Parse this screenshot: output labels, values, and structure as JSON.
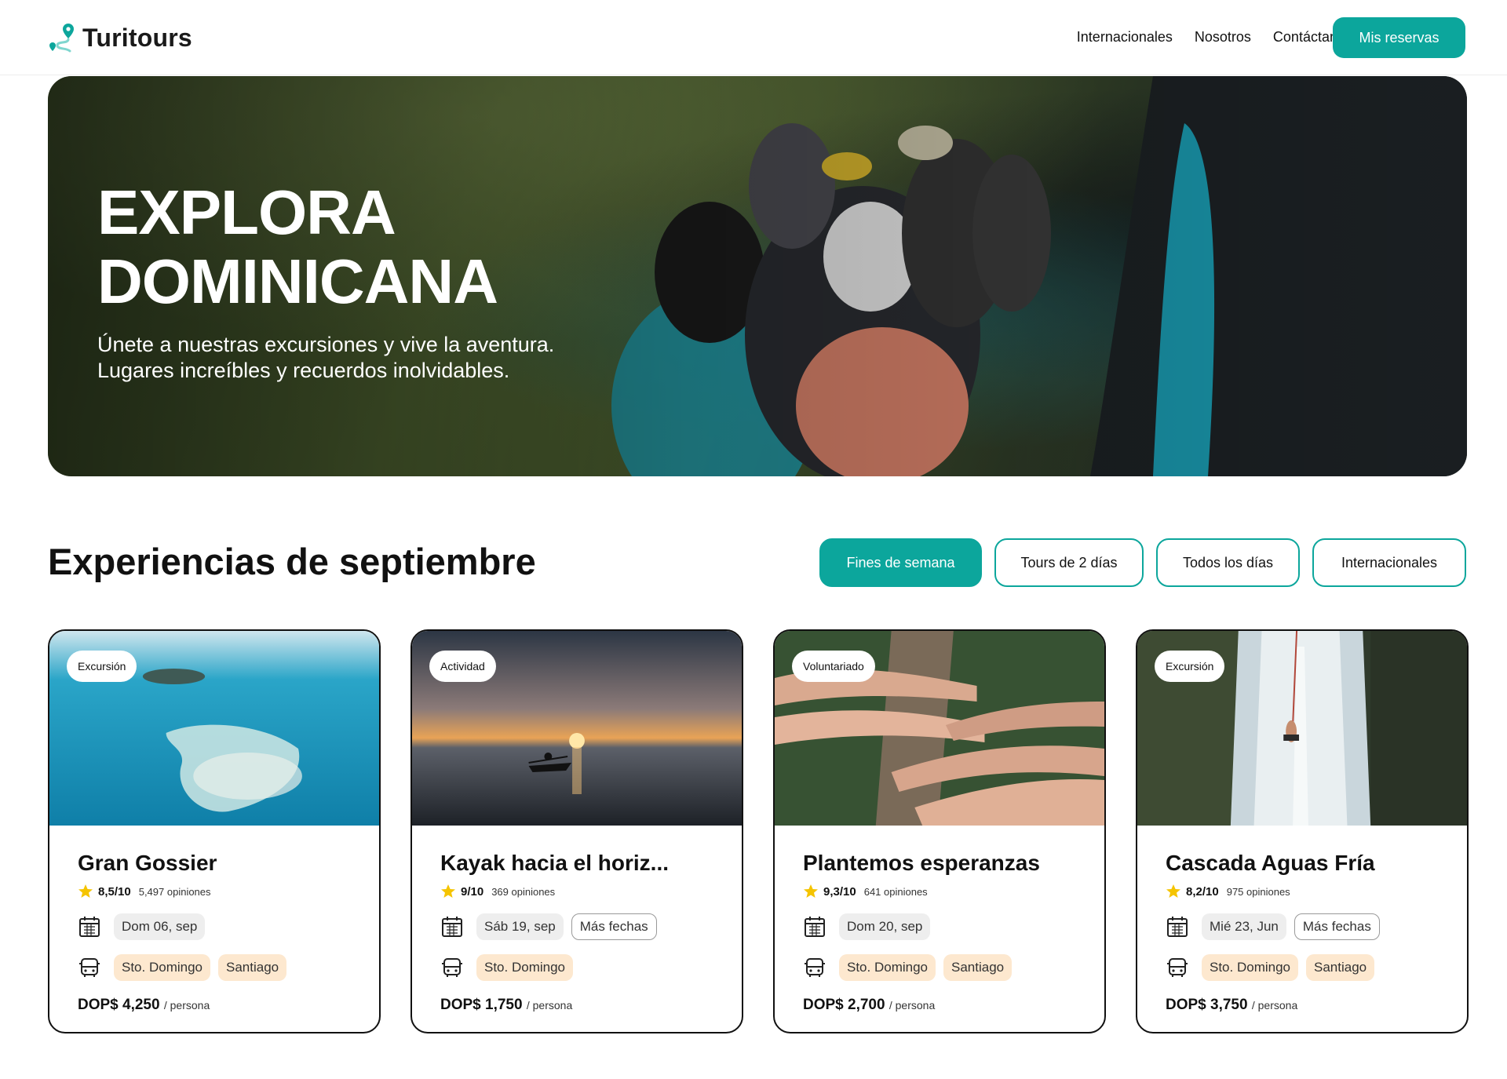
{
  "header": {
    "logo": "Turitours",
    "nav": [
      "Internacionales",
      "Nosotros",
      "Contáctanos"
    ],
    "cta": "Mis reservas"
  },
  "hero": {
    "title_line1": "EXPLORA",
    "title_line2": "DOMINICANA",
    "subtitle_line1": "Únete a nuestras excursiones y vive la aventura.",
    "subtitle_line2": "Lugares increíbles y recuerdos inolvidables."
  },
  "section": {
    "title": "Experiencias de septiembre",
    "filters": [
      {
        "label": "Fines de semana",
        "active": true
      },
      {
        "label": "Tours de 2 días",
        "active": false
      },
      {
        "label": "Todos los días",
        "active": false
      },
      {
        "label": "Internacionales",
        "active": false
      }
    ]
  },
  "cards": [
    {
      "tag": "Excursión",
      "title": "Gran Gossier",
      "score": "8,5/10",
      "reviews": "5,497 opiniones",
      "date": "Dom 06, sep",
      "more_dates": "",
      "locations": [
        "Sto. Domingo",
        "Santiago"
      ],
      "price": "DOP$ 4,250",
      "per": "/ persona"
    },
    {
      "tag": "Actividad",
      "title": "Kayak hacia el horiz...",
      "score": "9/10",
      "reviews": "369 opiniones",
      "date": "Sáb 19, sep",
      "more_dates": "Más fechas",
      "locations": [
        "Sto. Domingo"
      ],
      "price": "DOP$ 1,750",
      "per": "/ persona"
    },
    {
      "tag": "Voluntariado",
      "title": "Plantemos esperanzas",
      "score": "9,3/10",
      "reviews": "641 opiniones",
      "date": "Dom 20, sep",
      "more_dates": "",
      "locations": [
        "Sto. Domingo",
        "Santiago"
      ],
      "price": "DOP$ 2,700",
      "per": "/ persona"
    },
    {
      "tag": "Excursión",
      "title": "Cascada Aguas Fría",
      "score": "8,2/10",
      "reviews": "975 opiniones",
      "date": "Mié 23, Jun",
      "more_dates": "Más fechas",
      "locations": [
        "Sto. Domingo",
        "Santiago"
      ],
      "price": "DOP$ 3,750",
      "per": "/ persona"
    }
  ],
  "colors": {
    "accent": "#0ca69c",
    "location_chip": "#fde8cf",
    "star": "#f5c400"
  },
  "icons": {
    "calendar": "calendar-icon",
    "bus": "bus-icon",
    "star": "star-icon",
    "logo": "map-pin-route-icon"
  }
}
